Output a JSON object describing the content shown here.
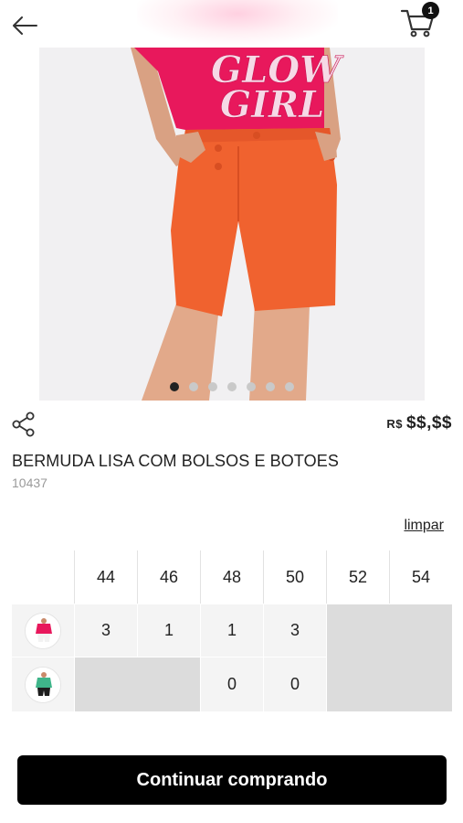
{
  "header": {
    "cart_count": "1"
  },
  "product": {
    "shirt_print": "GLOW GIRL",
    "name": "BERMUDA LISA COM BOLSOS E BOTOES",
    "sku": "10437",
    "price_currency": "R$",
    "price_value": "$$,$$",
    "image_count": 7,
    "active_image": 1
  },
  "actions": {
    "clear_label": "limpar",
    "continue_label": "Continuar comprando"
  },
  "size_grid": {
    "sizes": [
      "44",
      "46",
      "48",
      "50",
      "52",
      "54"
    ],
    "rows": [
      {
        "variant": "pink-top",
        "quantities": [
          "3",
          "1",
          "1",
          "3",
          null,
          null
        ]
      },
      {
        "variant": "green-top",
        "quantities": [
          null,
          null,
          "0",
          "0",
          null,
          null
        ]
      }
    ]
  },
  "colors": {
    "button_bg": "#000000",
    "pants": "#f0622f",
    "shirt": "#e8185c",
    "unavailable_cell": "#dcdcdc"
  }
}
